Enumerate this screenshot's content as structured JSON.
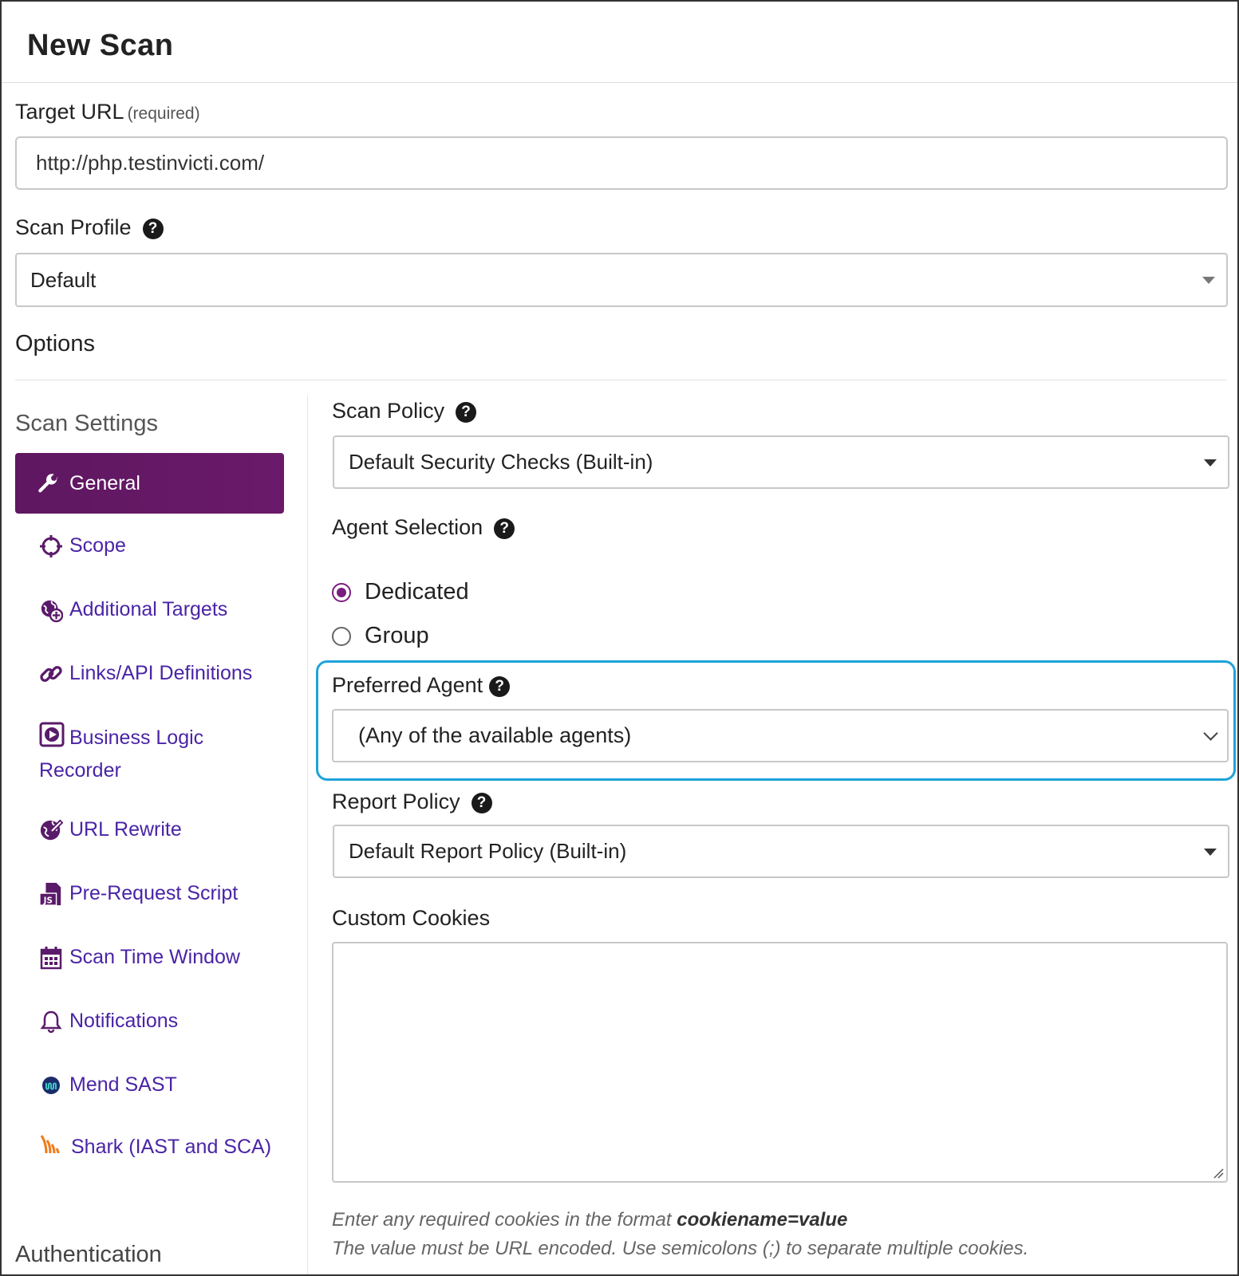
{
  "page": {
    "title": "New Scan"
  },
  "target_url": {
    "label": "Target URL",
    "required_note": "(required)",
    "value": "http://php.testinvicti.com/"
  },
  "scan_profile": {
    "label": "Scan Profile",
    "selected": "Default"
  },
  "options": {
    "title": "Options"
  },
  "sidebar": {
    "scan_settings_heading": "Scan Settings",
    "items": [
      {
        "label": "General",
        "icon": "wrench-icon",
        "active": true
      },
      {
        "label": "Scope",
        "icon": "crosshair-icon"
      },
      {
        "label": "Additional Targets",
        "icon": "globe-plus-icon"
      },
      {
        "label": "Links/API Definitions",
        "icon": "link-icon"
      },
      {
        "label": "Business Logic Recorder",
        "icon": "record-icon"
      },
      {
        "label": "URL Rewrite",
        "icon": "globe-edit-icon"
      },
      {
        "label": "Pre-Request Script",
        "icon": "js-file-icon"
      },
      {
        "label": "Scan Time Window",
        "icon": "calendar-icon"
      },
      {
        "label": "Notifications",
        "icon": "bell-icon"
      },
      {
        "label": "Mend SAST",
        "icon": "mend-logo-icon"
      },
      {
        "label": "Shark (IAST and SCA)",
        "icon": "shark-icon"
      }
    ],
    "authentication_heading": "Authentication"
  },
  "scan_policy": {
    "label": "Scan Policy",
    "selected": "Default Security Checks (Built-in)"
  },
  "agent_selection": {
    "label": "Agent Selection",
    "options": [
      {
        "label": "Dedicated",
        "checked": true
      },
      {
        "label": "Group",
        "checked": false
      }
    ]
  },
  "preferred_agent": {
    "label": "Preferred Agent",
    "selected": "(Any of the available agents)"
  },
  "report_policy": {
    "label": "Report Policy",
    "selected": "Default Report Policy (Built-in)"
  },
  "custom_cookies": {
    "label": "Custom Cookies",
    "value": "",
    "hint_line1_prefix": "Enter any required cookies in the format ",
    "hint_line1_format": "cookiename=value",
    "hint_line2": "The value must be URL encoded. Use semicolons (;) to separate multiple cookies."
  },
  "colors": {
    "accent": "#5e1760",
    "link": "#4a24a6",
    "focus": "#1ea3d9"
  }
}
